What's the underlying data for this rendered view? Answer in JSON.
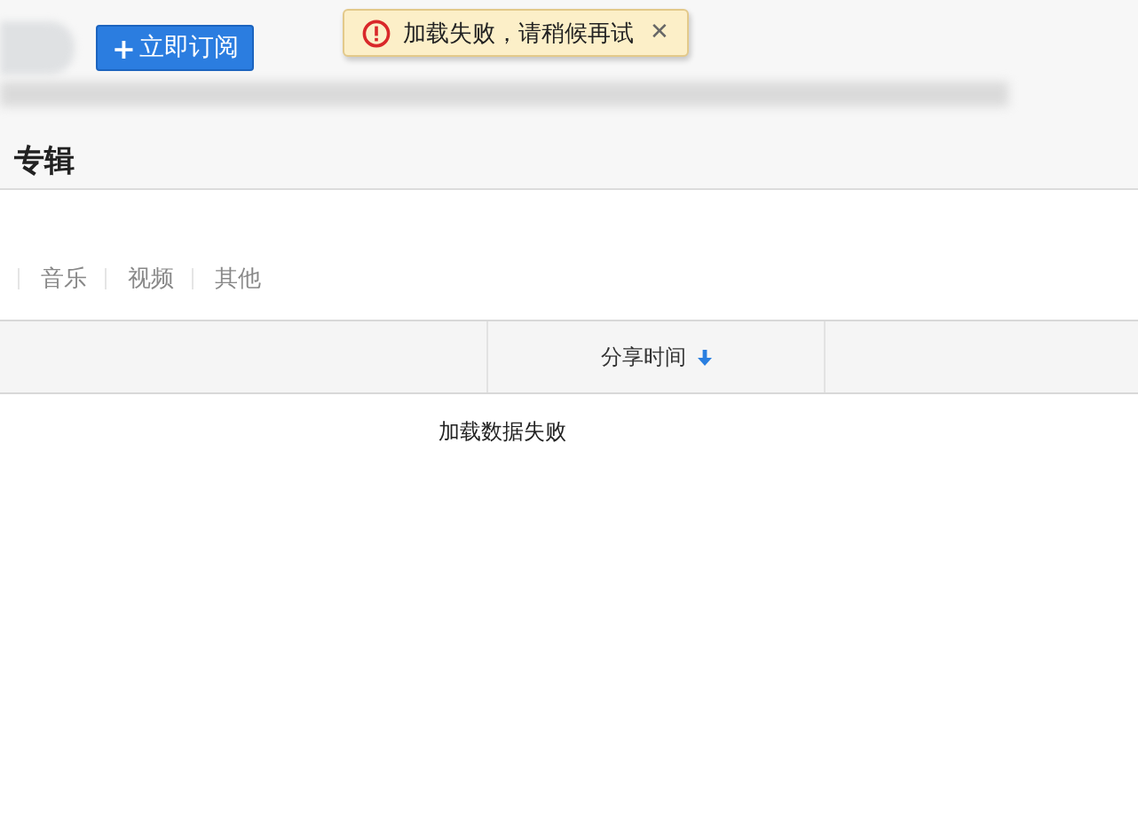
{
  "header": {
    "subscribe_button": {
      "icon": "+",
      "label": "立即订阅"
    },
    "title": "专辑"
  },
  "toast": {
    "message": "加载失败，请稍候再试",
    "close": "✕"
  },
  "filter_tabs": [
    {
      "label": "音乐"
    },
    {
      "label": "视频"
    },
    {
      "label": "其他"
    }
  ],
  "table": {
    "sort_column": {
      "label": "分享时间",
      "sorted": true
    },
    "empty_message": "加载数据失败"
  }
}
